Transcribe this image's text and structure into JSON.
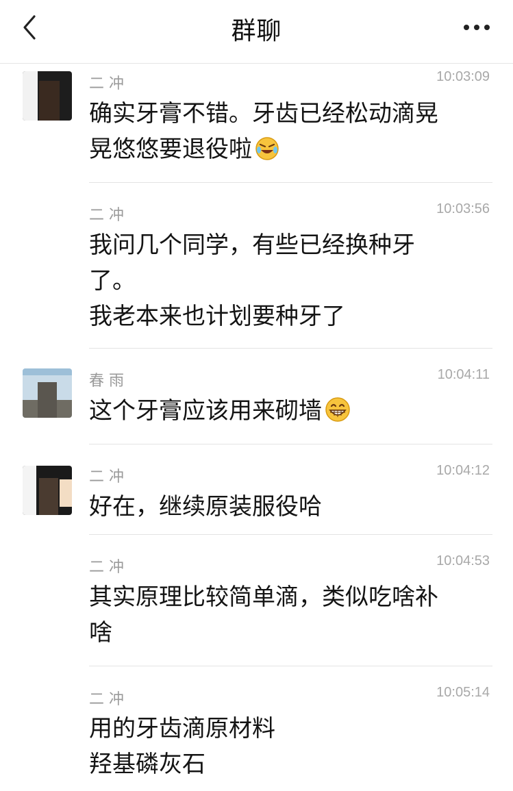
{
  "header": {
    "title": "群聊"
  },
  "messages": [
    {
      "sender": "二 冲",
      "time": "10:03:09",
      "lines": [
        "确实牙膏不错。牙齿已经松动滴晃",
        "晃悠悠要退役啦"
      ],
      "emoji": "laughing-tears-emoji"
    },
    {
      "sender": "二 冲",
      "time": "10:03:56",
      "lines": [
        "我问几个同学，有些已经换种牙",
        "了。",
        "我老本来也计划要种牙了"
      ]
    },
    {
      "sender": "春 雨",
      "time": "10:04:11",
      "lines": [
        "这个牙膏应该用来砌墙"
      ],
      "emoji": "grinning-emoji"
    },
    {
      "sender": "二 冲",
      "time": "10:04:12",
      "lines": [
        "好在，继续原装服役哈"
      ]
    },
    {
      "sender": "二 冲",
      "time": "10:04:53",
      "lines": [
        "其实原理比较简单滴，类似吃啥补",
        "啥"
      ]
    },
    {
      "sender": "二 冲",
      "time": "10:05:14",
      "lines": [
        "用的牙齿滴原材料",
        "羟基磷灰石"
      ]
    }
  ]
}
